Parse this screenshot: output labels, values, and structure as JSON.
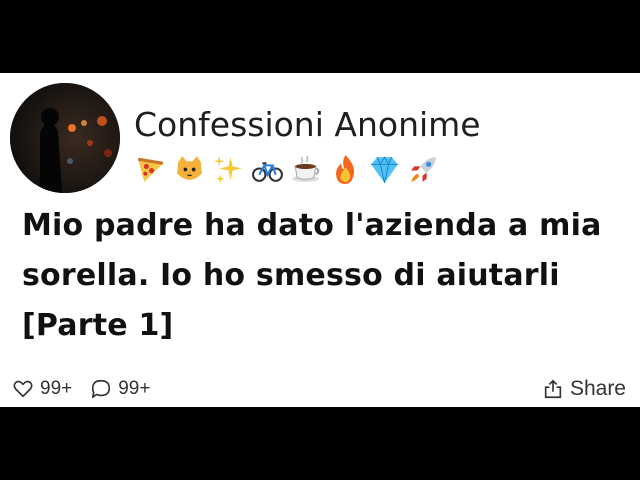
{
  "post": {
    "account_name": "Confessioni Anonime",
    "emojis": [
      "pizza",
      "cat-face",
      "sparkles",
      "bicycle",
      "hot-coffee",
      "fire",
      "gem",
      "rocket"
    ],
    "title": "Mio padre ha dato l'azienda a mia\nsorella. Io ho smesso di aiutarli\n[Parte 1]"
  },
  "footer": {
    "likes": "99+",
    "comments": "99+",
    "share_label": "Share"
  },
  "colors": {
    "card_background": "#ffffff",
    "frame_background": "#000000",
    "text": "#1f1f1f"
  }
}
